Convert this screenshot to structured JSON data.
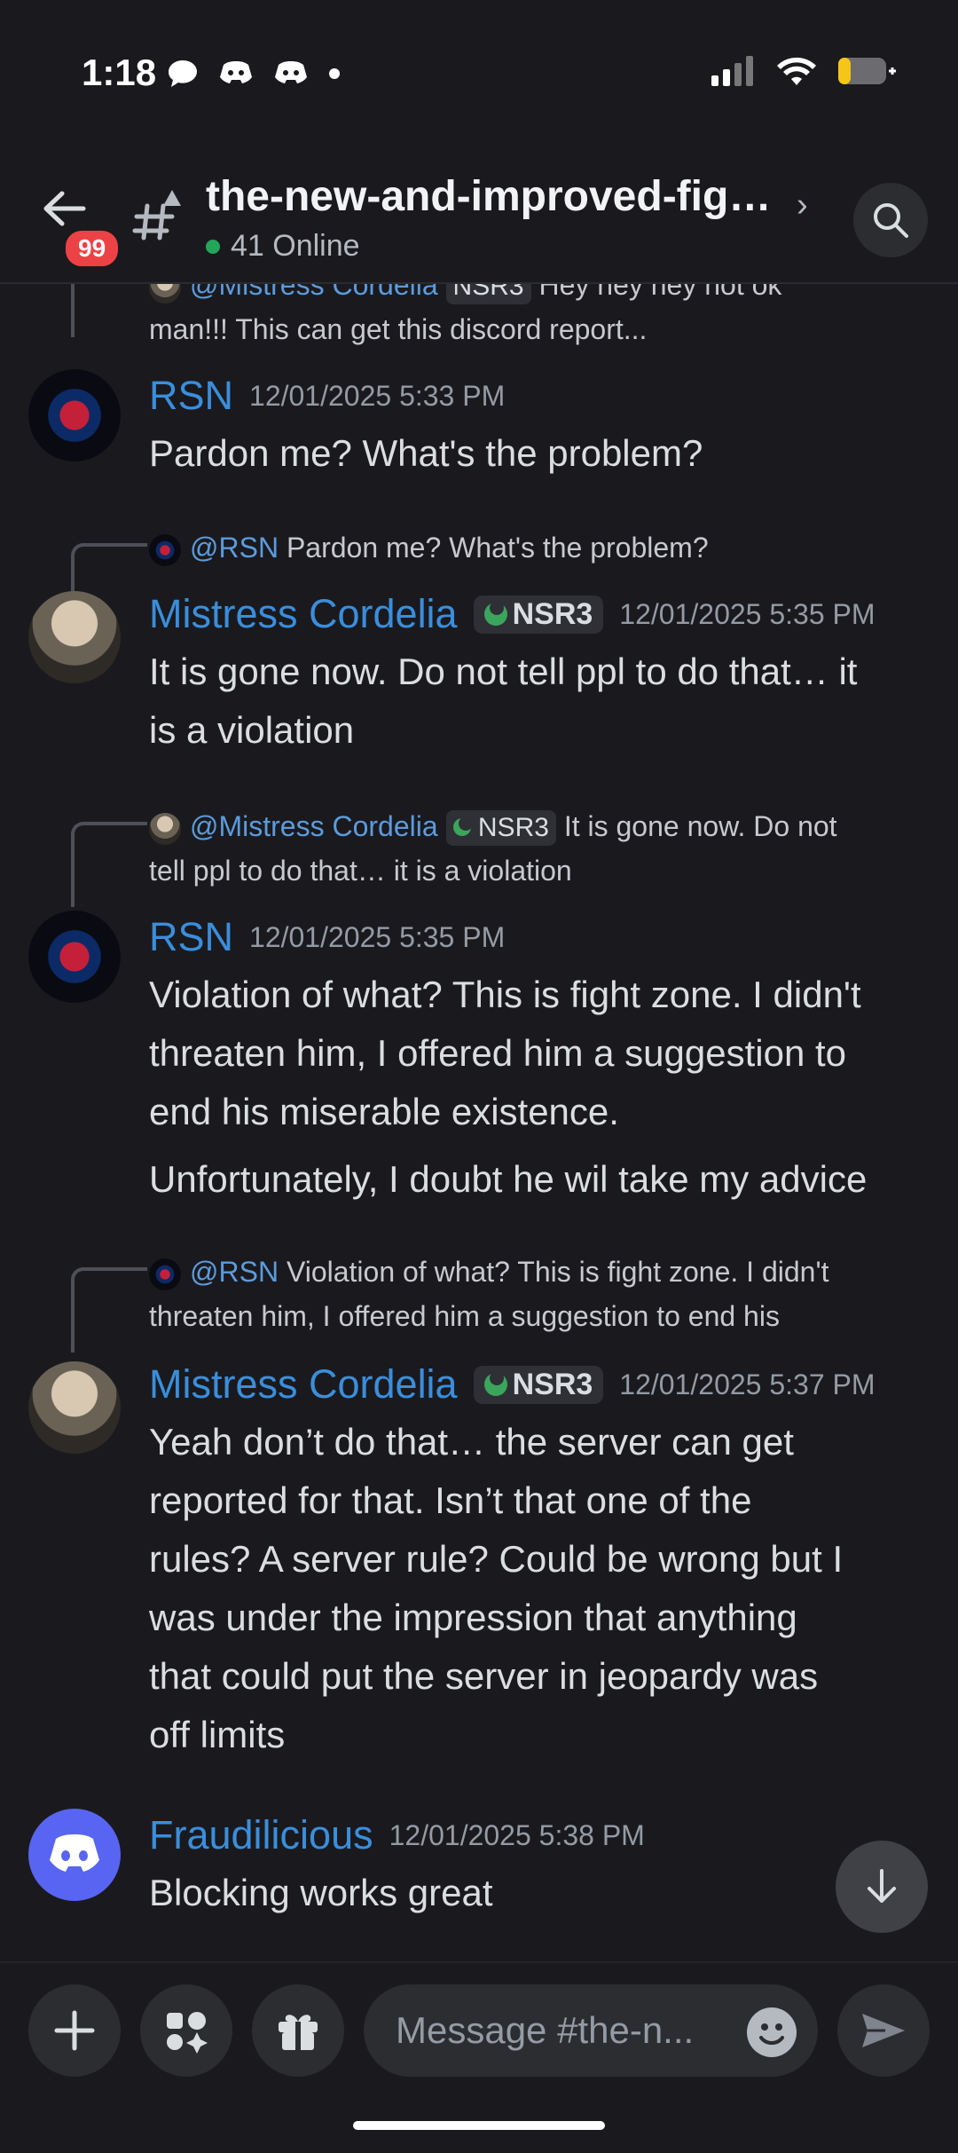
{
  "status_bar": {
    "time": "1:18"
  },
  "header": {
    "unread_badge": "99",
    "channel_title": "the-new-and-improved-fig…",
    "online_count": "41 Online"
  },
  "replies": [
    {
      "author": "@Mistress Cordelia",
      "tag": "NSR3",
      "line1": "Hey hey hey not ok",
      "line2": "man!!! This can get this discord report..."
    },
    {
      "author": "@RSN",
      "line1": "Pardon me? What's the problem?"
    },
    {
      "author": "@Mistress Cordelia",
      "tag": "NSR3",
      "line1": "It is gone now. Do not",
      "line2": "tell ppl to do that… it is a violation"
    },
    {
      "author": "@RSN",
      "line1": "Violation of what? This is fight zone. I didn't",
      "line2": "threaten him, I offered him a suggestion to end his"
    }
  ],
  "messages": [
    {
      "author": "RSN",
      "timestamp": "12/01/2025 5:33 PM",
      "lines": [
        "Pardon me? What's the problem?"
      ]
    },
    {
      "author": "Mistress Cordelia",
      "tag": "NSR3",
      "timestamp": "12/01/2025 5:35 PM",
      "lines": [
        "It is gone now. Do not tell ppl to do that… it",
        "is a violation"
      ]
    },
    {
      "author": "RSN",
      "timestamp": "12/01/2025 5:35 PM",
      "lines": [
        "Violation of what? This is fight zone. I didn't",
        "threaten him, I offered him a suggestion to",
        "end his miserable existence."
      ],
      "followup": "Unfortunately, I doubt he wil take my advice"
    },
    {
      "author": "Mistress Cordelia",
      "tag": "NSR3",
      "timestamp": "12/01/2025 5:37 PM",
      "lines": [
        "Yeah don’t do that… the server can get",
        "reported for that. Isn’t that one of the",
        "rules? A server rule? Could be wrong but I",
        "was under the impression that anything",
        "that could put the server in jeopardy was",
        "off limits"
      ]
    },
    {
      "author": "Fraudilicious",
      "timestamp": "12/01/2025 5:38 PM",
      "lines": [
        "Blocking works great"
      ]
    }
  ],
  "composer": {
    "placeholder": "Message #the-n..."
  },
  "colors": {
    "background": "#1a1a1e",
    "accent_name": "#3a8edc",
    "badge": "#ed4245",
    "online": "#23a55a",
    "discord_blurple": "#5865f2"
  },
  "icons": [
    "back-arrow-icon",
    "text-channel-alert-icon",
    "chevron-right-icon",
    "search-icon",
    "arrow-down-icon",
    "plus-icon",
    "apps-icon",
    "gift-icon",
    "emoji-icon",
    "send-icon"
  ]
}
